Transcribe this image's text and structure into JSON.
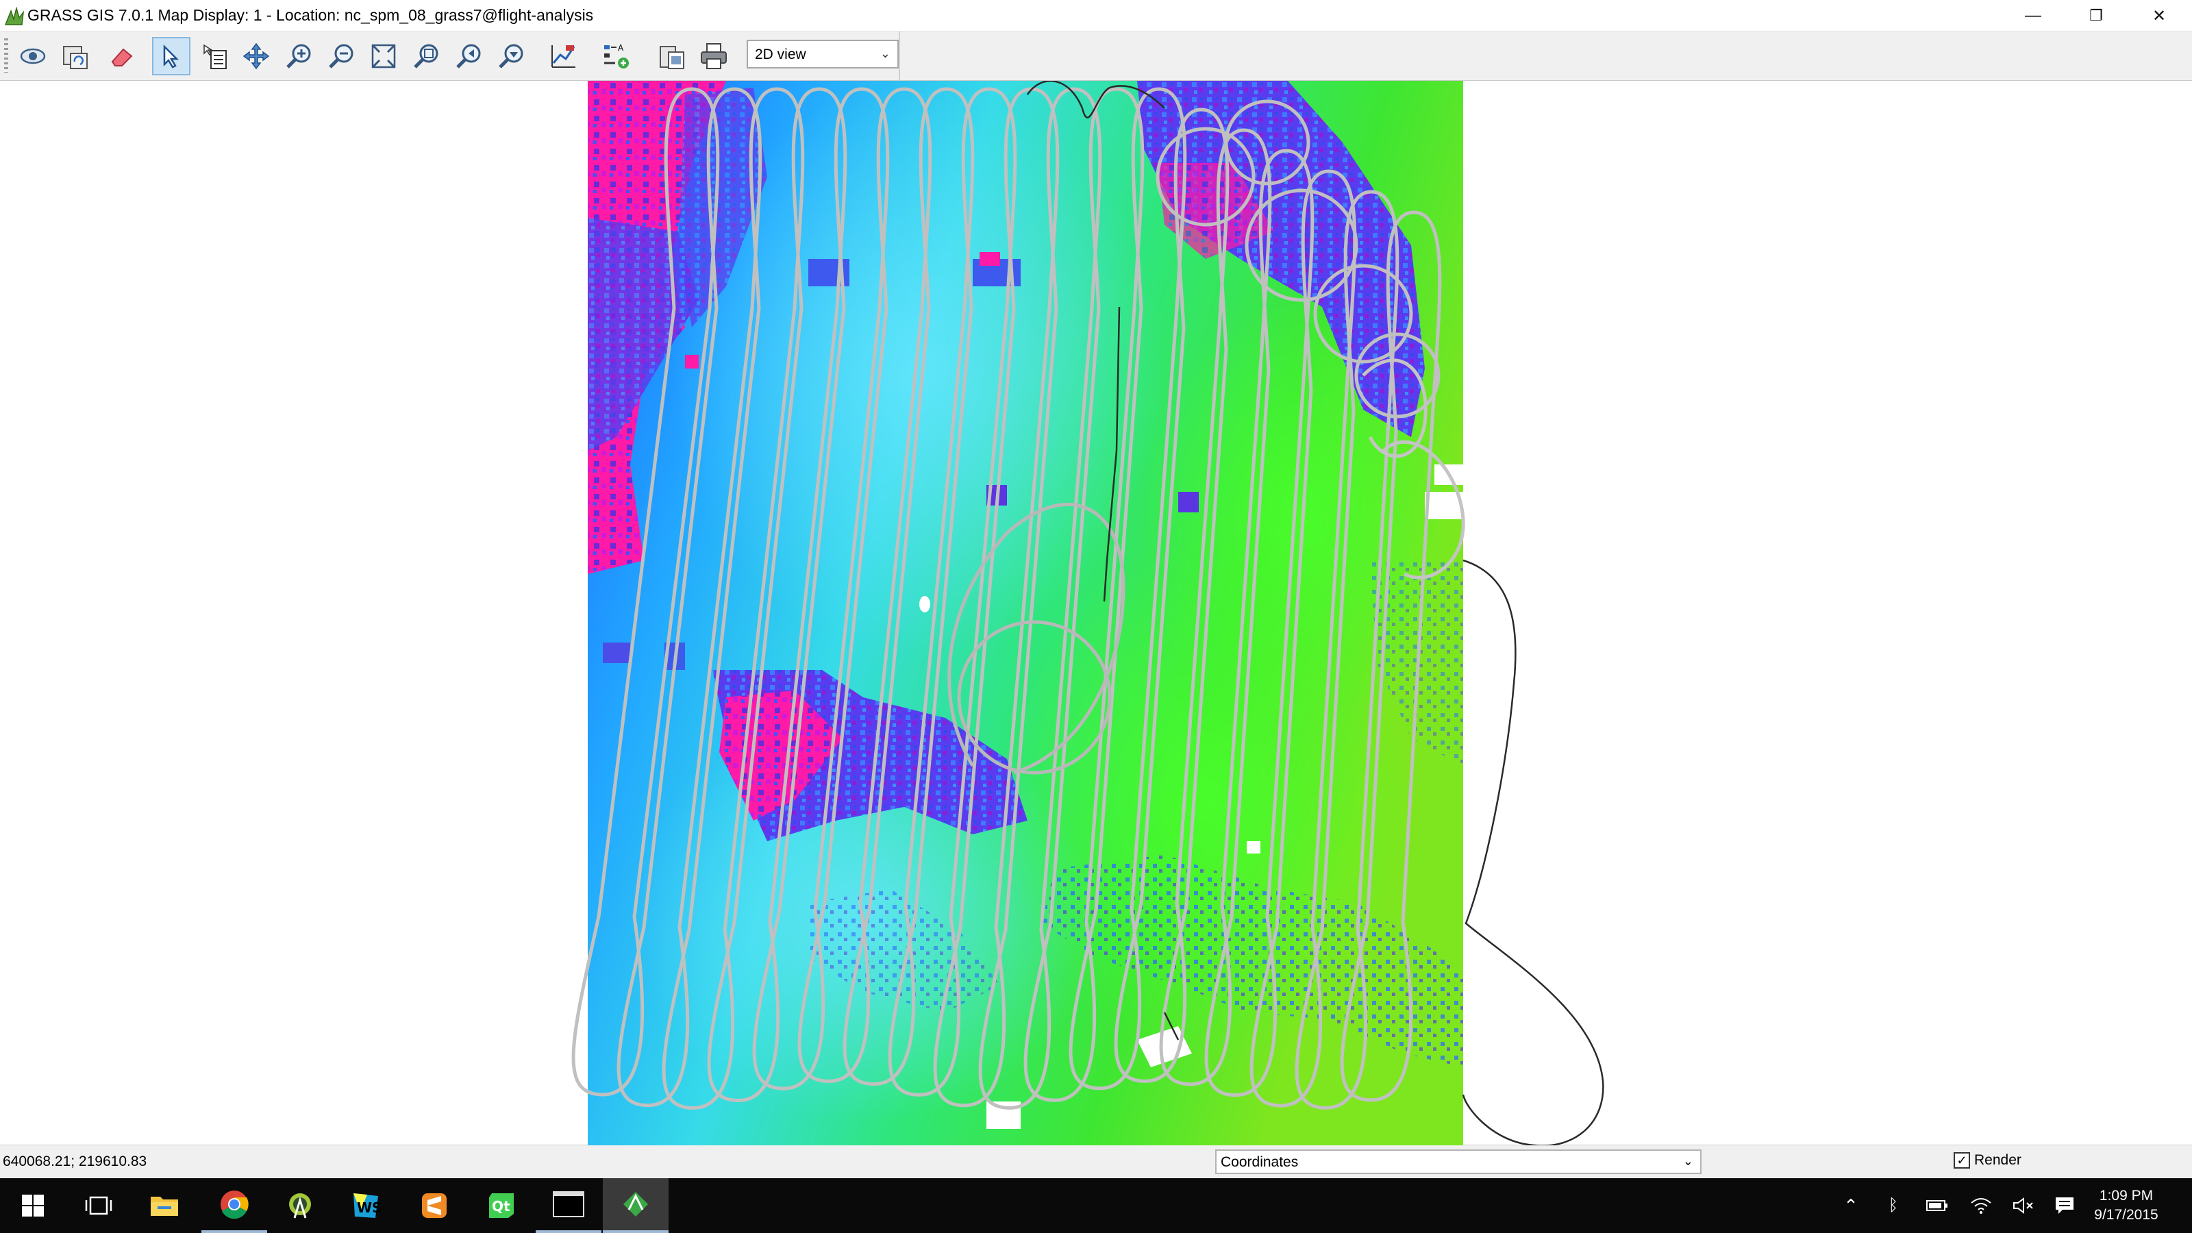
{
  "window": {
    "title": "GRASS GIS 7.0.1 Map Display: 1  - Location: nc_spm_08_grass7@flight-analysis",
    "minimize": "—",
    "restore": "❐",
    "close": "✕"
  },
  "toolbar": {
    "view_mode": "2D view",
    "tools": [
      "display-map",
      "render-map",
      "erase",
      "pointer",
      "query",
      "pan",
      "zoom-in",
      "zoom-out",
      "zoom-extent",
      "zoom-region",
      "zoom-back",
      "zoom-menu",
      "analyze",
      "legend-add",
      "save-image",
      "print"
    ]
  },
  "statusbar": {
    "coordinates": "640068.21; 219610.83",
    "mode": "Coordinates",
    "render_label": "Render",
    "render_checked": true
  },
  "taskbar": {
    "time": "1:09 PM",
    "date": "9/17/2015",
    "apps": [
      "start",
      "task-view",
      "file-explorer",
      "chrome",
      "android-studio",
      "webstorm",
      "sublime",
      "qt-creator",
      "terminal",
      "grass-gis"
    ]
  },
  "colors": {
    "map_blue": "#1e6cff",
    "map_cyan": "#33d6f0",
    "map_green": "#39e23a",
    "map_magenta": "#ff1aa8",
    "map_purple": "#6a2bd8",
    "flight_path": "#c0c0c0",
    "taskbar": "#0a0a0a"
  }
}
